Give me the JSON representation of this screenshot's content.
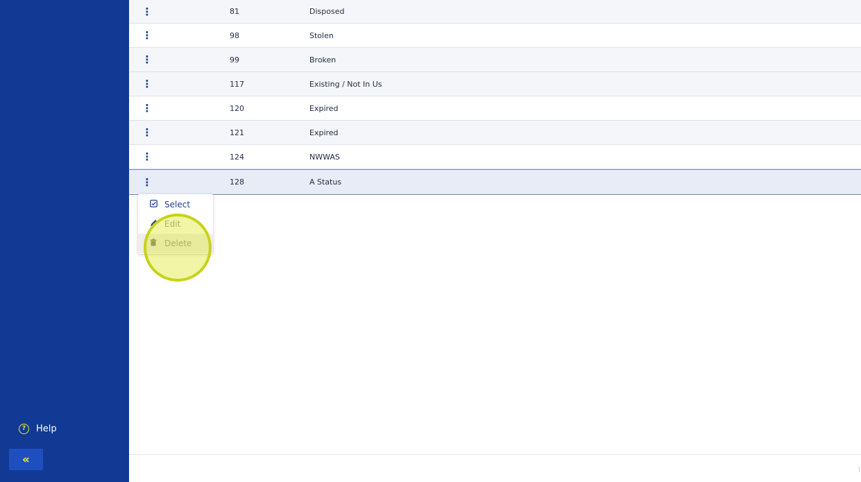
{
  "sidebar": {
    "help_label": "Help",
    "help_icon": "question-circle-icon",
    "collapse_icon": "double-chevron-left-icon",
    "collapse_glyph": "«",
    "bg_color": "#123a94",
    "accent_color": "#e4ec3a"
  },
  "table": {
    "rows": [
      {
        "id": "81",
        "name": "Disposed"
      },
      {
        "id": "98",
        "name": "Stolen"
      },
      {
        "id": "99",
        "name": "Broken"
      },
      {
        "id": "117",
        "name": "Existing / Not In Us"
      },
      {
        "id": "120",
        "name": "Expired"
      },
      {
        "id": "121",
        "name": "Expired"
      },
      {
        "id": "124",
        "name": "NWWAS"
      },
      {
        "id": "128",
        "name": "A Status"
      }
    ],
    "selected_row_index": 7
  },
  "context_menu": {
    "items": [
      {
        "label": "Select",
        "icon": "checkbox-icon",
        "enabled": true
      },
      {
        "label": "Edit",
        "icon": "pencil-icon",
        "enabled": false
      },
      {
        "label": "Delete",
        "icon": "trash-icon",
        "enabled": false
      }
    ]
  }
}
